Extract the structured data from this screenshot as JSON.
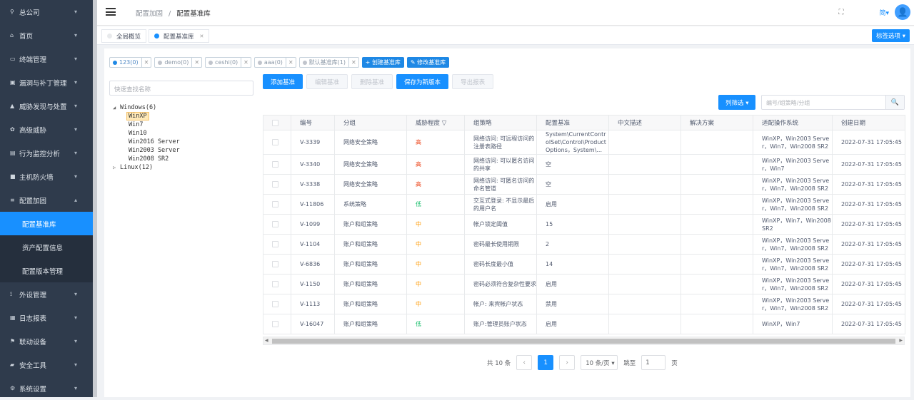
{
  "sidebar": {
    "items": [
      {
        "label": "总公司",
        "icon": "map-pin-icon",
        "chev": "▾"
      },
      {
        "label": "首页",
        "icon": "home-icon",
        "chev": "▾"
      },
      {
        "label": "终端管理",
        "icon": "monitor-icon",
        "chev": "▾"
      },
      {
        "label": "漏洞与补丁管理",
        "icon": "lock-icon",
        "chev": "▾"
      },
      {
        "label": "威胁发现与处置",
        "icon": "warning-icon",
        "chev": "▾"
      },
      {
        "label": "高级威胁",
        "icon": "biohazard-icon",
        "chev": "▾"
      },
      {
        "label": "行为监控分析",
        "icon": "report-icon",
        "chev": "▾"
      },
      {
        "label": "主机防火墙",
        "icon": "firewall-icon",
        "chev": "▾"
      },
      {
        "label": "配置加固",
        "icon": "sliders-icon",
        "chev": "▴"
      }
    ],
    "subitems": [
      "配置基准库",
      "资产配置信息",
      "配置版本管理"
    ],
    "items_after": [
      {
        "label": "外设管理",
        "icon": "usb-icon",
        "chev": "▾"
      },
      {
        "label": "日志报表",
        "icon": "calendar-icon",
        "chev": "▾"
      },
      {
        "label": "联动设备",
        "icon": "flag-icon",
        "chev": "▾"
      },
      {
        "label": "安全工具",
        "icon": "toolbox-icon",
        "chev": "▾"
      },
      {
        "label": "系统设置",
        "icon": "gear-icon",
        "chev": "▾"
      }
    ]
  },
  "header": {
    "breadcrumb_parent": "配置加固",
    "breadcrumb_sep": "/",
    "breadcrumb_current": "配置基准库",
    "fullscreen_glyph": "⛶",
    "lang_label": "简▾",
    "avatar_glyph": "👤"
  },
  "tags": {
    "tab1": "全局概览",
    "tab2": "配置基准库",
    "close": "✕",
    "options_label": "标签选项 ▾"
  },
  "baselines": {
    "chips": [
      {
        "label": "123(0)",
        "color": "#1e88e5"
      },
      {
        "label": "demo(0)",
        "color": "#c0c4cc"
      },
      {
        "label": "ceshi(0)",
        "color": "#c0c4cc"
      },
      {
        "label": "aaa(0)",
        "color": "#c0c4cc"
      },
      {
        "label": "默认基准库(1)",
        "color": "#c0c4cc"
      }
    ],
    "close_glyph": "✕",
    "create_label": "+ 创建基准库",
    "edit_label": "✎ 修改基准库"
  },
  "tree": {
    "search_placeholder": "快速查找名称",
    "windows": "Windows(6)",
    "windows_children": [
      "WinXP",
      "Win7",
      "Win10",
      "Win2016 Server",
      "Win2003 Server",
      "Win2008 SR2"
    ],
    "linux": "Linux(12)",
    "expanded_glyph": "◢",
    "collapsed_glyph": "▷"
  },
  "actions": {
    "add": "添加基准",
    "edit": "编辑基准",
    "delete": "删除基准",
    "save_version": "保存为新版本",
    "export": "导出报表"
  },
  "filter": {
    "column_filter_label": "列筛选 ▾",
    "search_placeholder": "编号/组策略/分组",
    "search_icon_glyph": "🔍"
  },
  "table": {
    "headers": [
      "编号",
      "分组",
      "威胁程度 ▽",
      "组策略",
      "配置基准",
      "中文描述",
      "解决方案",
      "适配操作系统",
      "创建日期"
    ],
    "rows": [
      {
        "id": "V-3339",
        "group": "网络安全策略",
        "level": "高",
        "lvl": "high",
        "policy": "网络访问: 可远程访问的注册表路径",
        "baseline": "System\\CurrentControlSet\\Control\\ProductOptions，System\\...",
        "desc": "",
        "solution": "",
        "os": "WinXP，Win2003 Server，Win7，Win2008 SR2",
        "date": "2022-07-31 17:05:45"
      },
      {
        "id": "V-3340",
        "group": "网络安全策略",
        "level": "高",
        "lvl": "high",
        "policy": "网络访问: 可以匿名访问的共享",
        "baseline": "空",
        "desc": "",
        "solution": "",
        "os": "WinXP，Win2003 Server，Win7",
        "date": "2022-07-31 17:05:45"
      },
      {
        "id": "V-3338",
        "group": "网络安全策略",
        "level": "高",
        "lvl": "high",
        "policy": "网络访问: 可匿名访问的命名管道",
        "baseline": "空",
        "desc": "",
        "solution": "",
        "os": "WinXP，Win2003 Server，Win7，Win2008 SR2",
        "date": "2022-07-31 17:05:45"
      },
      {
        "id": "V-11806",
        "group": "系统策略",
        "level": "低",
        "lvl": "low",
        "policy": "交互式登录: 不显示最后的用户名",
        "baseline": "启用",
        "desc": "",
        "solution": "",
        "os": "WinXP，Win2003 Server，Win7，Win2008 SR2",
        "date": "2022-07-31 17:05:45"
      },
      {
        "id": "V-1099",
        "group": "账户和组策略",
        "level": "中",
        "lvl": "mid",
        "policy": "帐户锁定阈值",
        "baseline": "15",
        "desc": "",
        "solution": "",
        "os": "WinXP，Win7，Win2008 SR2",
        "date": "2022-07-31 17:05:45"
      },
      {
        "id": "V-1104",
        "group": "账户和组策略",
        "level": "中",
        "lvl": "mid",
        "policy": "密码最长使用期限",
        "baseline": "2",
        "desc": "",
        "solution": "",
        "os": "WinXP，Win2003 Server，Win7，Win2008 SR2",
        "date": "2022-07-31 17:05:45"
      },
      {
        "id": "V-6836",
        "group": "账户和组策略",
        "level": "中",
        "lvl": "mid",
        "policy": "密码长度最小值",
        "baseline": "14",
        "desc": "",
        "solution": "",
        "os": "WinXP，Win2003 Server，Win7，Win2008 SR2",
        "date": "2022-07-31 17:05:45"
      },
      {
        "id": "V-1150",
        "group": "账户和组策略",
        "level": "中",
        "lvl": "mid",
        "policy": "密码必须符合复杂性要求",
        "baseline": "启用",
        "desc": "",
        "solution": "",
        "os": "WinXP，Win2003 Server，Win7，Win2008 SR2",
        "date": "2022-07-31 17:05:45"
      },
      {
        "id": "V-1113",
        "group": "账户和组策略",
        "level": "中",
        "lvl": "mid",
        "policy": "帐户: 来宾帐户状态",
        "baseline": "禁用",
        "desc": "",
        "solution": "",
        "os": "WinXP，Win2003 Server，Win7，Win2008 SR2",
        "date": "2022-07-31 17:05:45"
      },
      {
        "id": "V-16047",
        "group": "账户和组策略",
        "level": "低",
        "lvl": "low",
        "policy": "账户:管理员账户状态",
        "baseline": "启用",
        "desc": "",
        "solution": "",
        "os": "WinXP，Win7",
        "date": "2022-07-31 17:05:45"
      }
    ]
  },
  "pagination": {
    "total": "共 10 条",
    "prev": "‹",
    "page": "1",
    "next": "›",
    "page_size": "10 条/页 ▾",
    "goto_label": "跳至",
    "goto_value": "1",
    "page_unit": "页"
  },
  "colors": {
    "accent": "#1890ff",
    "sidebar_bg": "#2f3b4c",
    "high": "#ed4014",
    "mid": "#ff9900",
    "low": "#19be6b"
  }
}
